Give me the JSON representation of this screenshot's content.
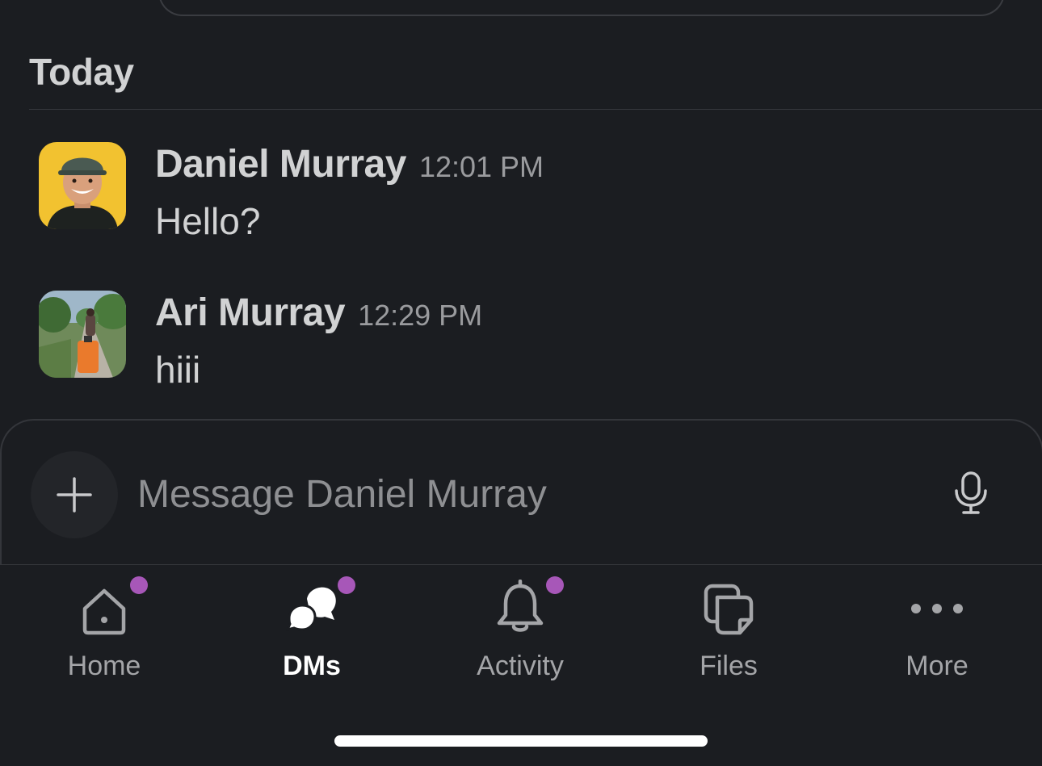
{
  "conversation": {
    "day_header": "Today",
    "messages": [
      {
        "author": "Daniel Murray",
        "time": "12:01 PM",
        "text": "Hello?",
        "avatar": "person-avatar-yellow"
      },
      {
        "author": "Ari Murray",
        "time": "12:29 PM",
        "text": "hiii",
        "avatar": "photo-avatar-outdoor"
      }
    ]
  },
  "composer": {
    "placeholder": "Message Daniel Murray",
    "value": "",
    "add_icon": "plus-icon",
    "mic_icon": "microphone-icon"
  },
  "tabbar": {
    "tabs": [
      {
        "label": "Home",
        "icon": "home-icon",
        "active": false,
        "badge": true
      },
      {
        "label": "DMs",
        "icon": "dms-icon",
        "active": true,
        "badge": true
      },
      {
        "label": "Activity",
        "icon": "bell-icon",
        "active": false,
        "badge": true
      },
      {
        "label": "Files",
        "icon": "files-icon",
        "active": false,
        "badge": false
      },
      {
        "label": "More",
        "icon": "more-icon",
        "active": false,
        "badge": false
      }
    ]
  },
  "colors": {
    "background": "#1b1d21",
    "text": "#d1d2d3",
    "muted": "#9a9b9e",
    "badge": "#a757b8",
    "avatar_yellow": "#f2c230"
  }
}
